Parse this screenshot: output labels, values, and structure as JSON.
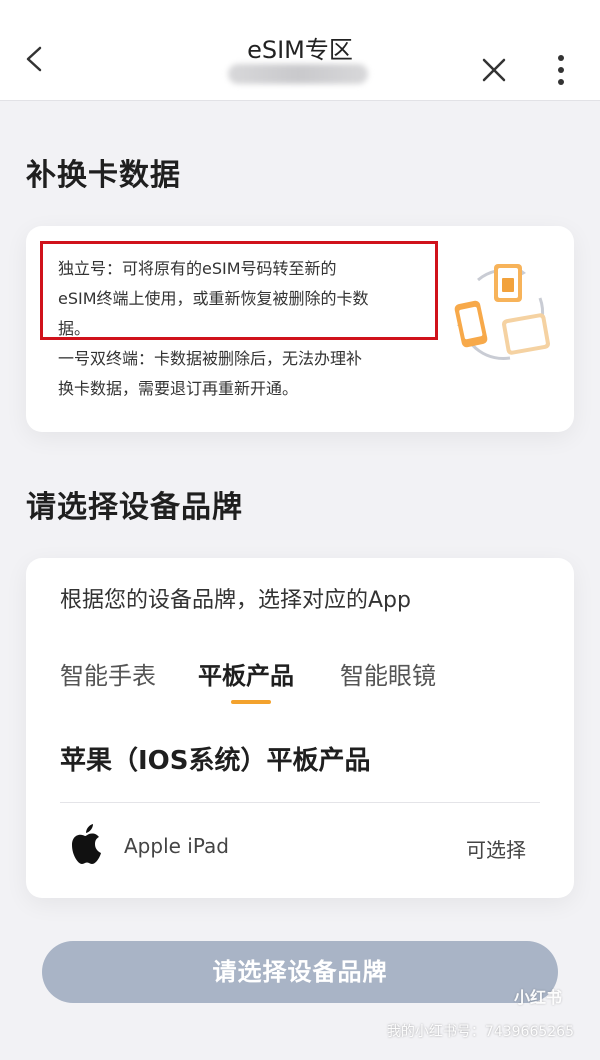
{
  "nav": {
    "title": "eSIM专区",
    "back_icon": "chevron-left-icon",
    "close_icon": "close-icon",
    "more_icon": "more-vertical-icon"
  },
  "section1": {
    "title": "补换卡数据",
    "info_lines": [
      "独立号：可将原有的eSIM号码转至新的",
      "eSIM终端上使用，或重新恢复被删除的卡数",
      "据。",
      "一号双终端：卡数据被删除后，无法办理补",
      "换卡数据，需要退订再重新开通。"
    ],
    "illustration": "sim-transfer-illustration"
  },
  "section2": {
    "title": "请选择设备品牌",
    "hint": "根据您的设备品牌，选择对应的App",
    "tabs": [
      {
        "label": "智能手表",
        "active": false
      },
      {
        "label": "平板产品",
        "active": true
      },
      {
        "label": "智能眼镜",
        "active": false
      }
    ],
    "os_title": "苹果（IOS系统）平板产品",
    "device": {
      "icon": "apple-logo-icon",
      "name": "Apple iPad",
      "status": "可选择"
    }
  },
  "submit_label": "请选择设备品牌",
  "watermark": {
    "logo": "小红书",
    "id_text": "我的小红书号：7439665265"
  },
  "colors": {
    "accent_underline": "#f3a22d",
    "highlight_border": "#d0121b",
    "button_disabled": "#a9b4c6"
  }
}
